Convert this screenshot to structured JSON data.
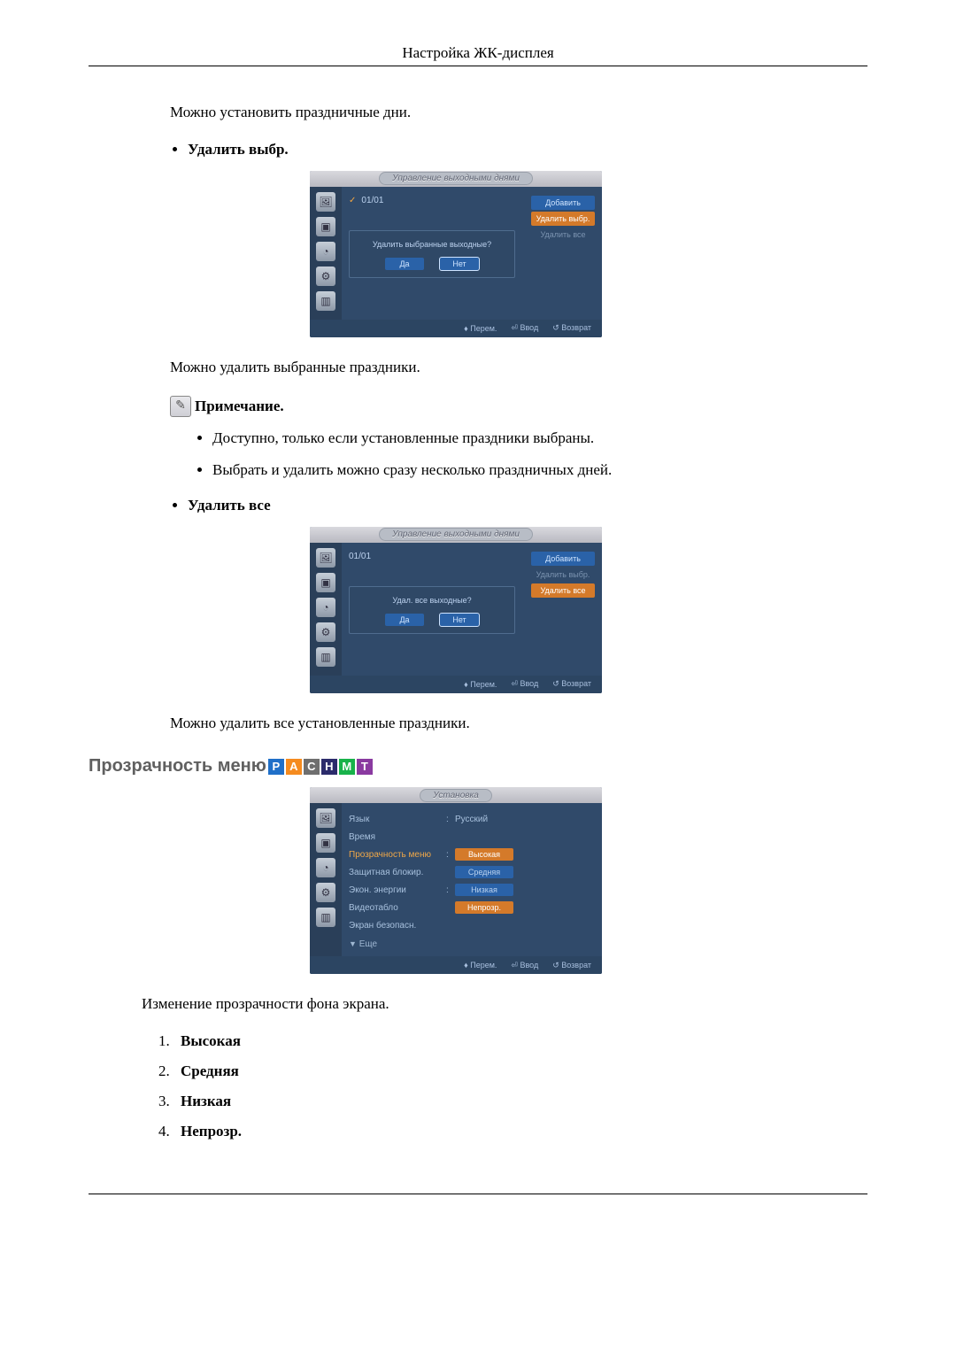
{
  "header": {
    "title": "Настройка ЖК-дисплея"
  },
  "intro_para": "Можно установить праздничные дни.",
  "delete_sel": {
    "heading": "Удалить выбр.",
    "osd_title": "Управление выходными днями",
    "date": "01/01",
    "btn_add": "Добавить",
    "btn_del_sel": "Удалить выбр.",
    "btn_del_all": "Удалить все",
    "dialog_q": "Удалить выбранные выходные?",
    "yes": "Да",
    "no": "Нет",
    "foot_move": "Перем.",
    "foot_enter": "Ввод",
    "foot_return": "Возврат",
    "after": "Можно удалить выбранные праздники."
  },
  "note": {
    "label": "Примечание.",
    "items": [
      "Доступно, только если установленные праздники выбраны.",
      "Выбрать и удалить можно сразу несколько праздничных дней."
    ]
  },
  "delete_all": {
    "heading": "Удалить все",
    "osd_title": "Управление выходными днями",
    "date": "01/01",
    "btn_add": "Добавить",
    "btn_del_sel": "Удалить выбр.",
    "btn_del_all": "Удалить все",
    "dialog_q": "Удал. все выходные?",
    "yes": "Да",
    "no": "Нет",
    "foot_move": "Перем.",
    "foot_enter": "Ввод",
    "foot_return": "Возврат",
    "after": "Можно удалить все установленные праздники."
  },
  "transparency": {
    "title": "Прозрачность меню",
    "badges": [
      "P",
      "A",
      "C",
      "H",
      "M",
      "T"
    ],
    "osd_title": "Установка",
    "menu": {
      "lang_label": "Язык",
      "lang_value": "Русский",
      "time_label": "Время",
      "trans_label": "Прозрачность меню",
      "lock_label": "Защитная блокир.",
      "eco_label": "Экон. энергии",
      "video_label": "Видеотабло",
      "safety_label": "Экран безопасн.",
      "more": "Еще"
    },
    "options": {
      "high": "Высокая",
      "mid": "Средняя",
      "low": "Низкая",
      "opaque": "Непрозр."
    },
    "foot_move": "Перем.",
    "foot_enter": "Ввод",
    "foot_return": "Возврат",
    "after": "Изменение прозрачности фона экрана.",
    "list": [
      "Высокая",
      "Средняя",
      "Низкая",
      "Непрозр."
    ]
  }
}
